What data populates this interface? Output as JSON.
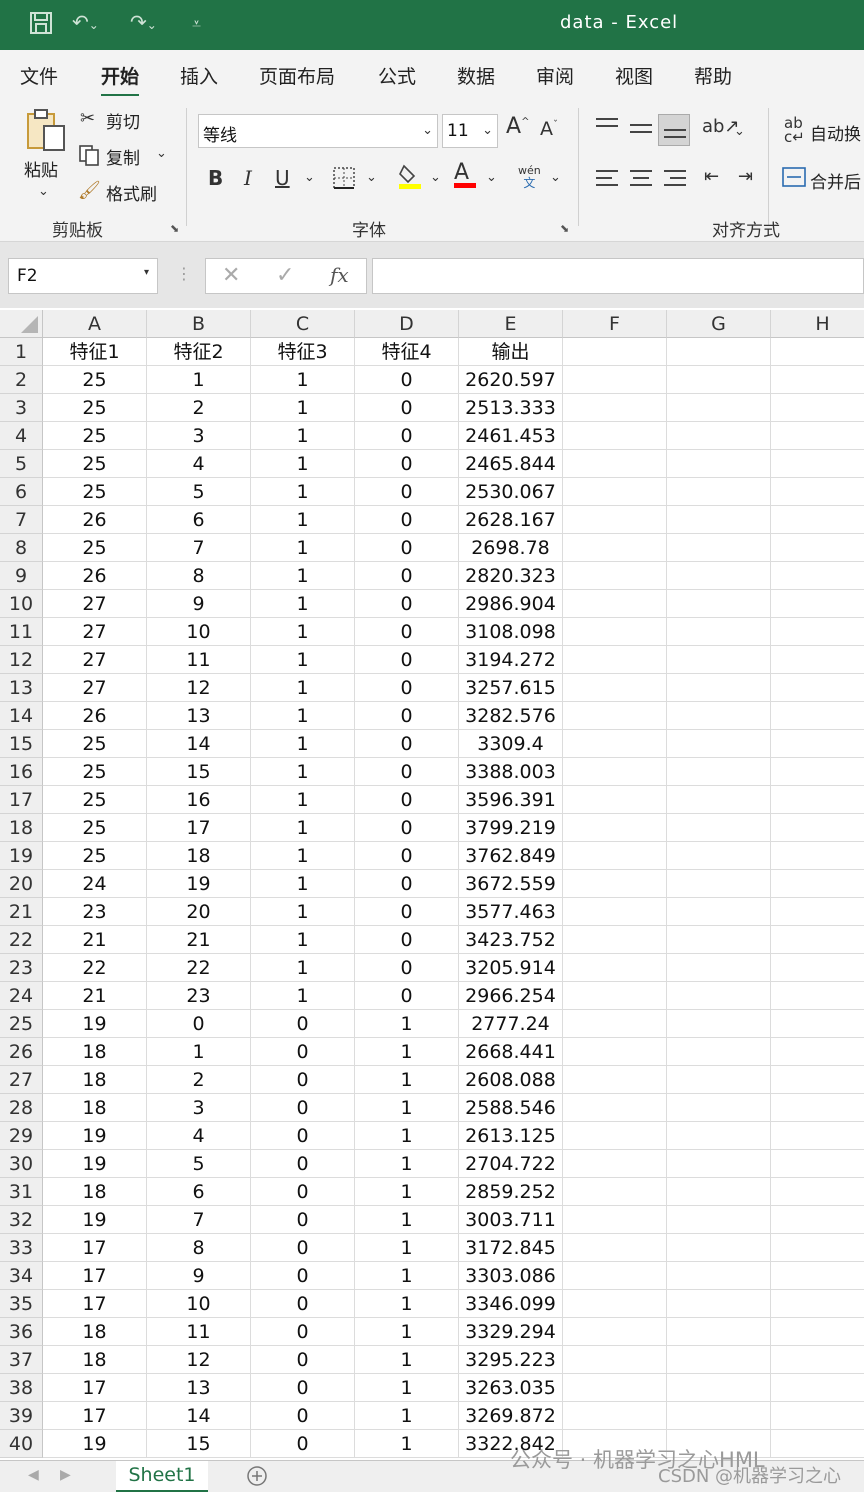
{
  "window": {
    "title": "data  -  Excel"
  },
  "menu": {
    "tabs": [
      "文件",
      "开始",
      "插入",
      "页面布局",
      "公式",
      "数据",
      "审阅",
      "视图",
      "帮助"
    ],
    "active": "开始"
  },
  "ribbon": {
    "clipboard": {
      "paste": "粘贴",
      "cut": "剪切",
      "copy": "复制",
      "format_painter": "格式刷",
      "group": "剪贴板"
    },
    "font": {
      "name": "等线",
      "size": "11",
      "group": "字体",
      "bold": "B",
      "italic": "I",
      "underline": "U",
      "font_color": "A",
      "phonetic_top": "wén",
      "phonetic_bottom": "文"
    },
    "alignment": {
      "wrap": "自动换",
      "merge": "合并后",
      "group": "对齐方式"
    }
  },
  "formula": {
    "name_box": "F2",
    "value": ""
  },
  "grid": {
    "columns": [
      "A",
      "B",
      "C",
      "D",
      "E",
      "F",
      "G",
      "H"
    ],
    "headers": [
      "特征1",
      "特征2",
      "特征3",
      "特征4",
      "输出"
    ],
    "rows": [
      [
        "25",
        "1",
        "1",
        "0",
        "2620.597"
      ],
      [
        "25",
        "2",
        "1",
        "0",
        "2513.333"
      ],
      [
        "25",
        "3",
        "1",
        "0",
        "2461.453"
      ],
      [
        "25",
        "4",
        "1",
        "0",
        "2465.844"
      ],
      [
        "25",
        "5",
        "1",
        "0",
        "2530.067"
      ],
      [
        "26",
        "6",
        "1",
        "0",
        "2628.167"
      ],
      [
        "25",
        "7",
        "1",
        "0",
        "2698.78"
      ],
      [
        "26",
        "8",
        "1",
        "0",
        "2820.323"
      ],
      [
        "27",
        "9",
        "1",
        "0",
        "2986.904"
      ],
      [
        "27",
        "10",
        "1",
        "0",
        "3108.098"
      ],
      [
        "27",
        "11",
        "1",
        "0",
        "3194.272"
      ],
      [
        "27",
        "12",
        "1",
        "0",
        "3257.615"
      ],
      [
        "26",
        "13",
        "1",
        "0",
        "3282.576"
      ],
      [
        "25",
        "14",
        "1",
        "0",
        "3309.4"
      ],
      [
        "25",
        "15",
        "1",
        "0",
        "3388.003"
      ],
      [
        "25",
        "16",
        "1",
        "0",
        "3596.391"
      ],
      [
        "25",
        "17",
        "1",
        "0",
        "3799.219"
      ],
      [
        "25",
        "18",
        "1",
        "0",
        "3762.849"
      ],
      [
        "24",
        "19",
        "1",
        "0",
        "3672.559"
      ],
      [
        "23",
        "20",
        "1",
        "0",
        "3577.463"
      ],
      [
        "21",
        "21",
        "1",
        "0",
        "3423.752"
      ],
      [
        "22",
        "22",
        "1",
        "0",
        "3205.914"
      ],
      [
        "21",
        "23",
        "1",
        "0",
        "2966.254"
      ],
      [
        "19",
        "0",
        "0",
        "1",
        "2777.24"
      ],
      [
        "18",
        "1",
        "0",
        "1",
        "2668.441"
      ],
      [
        "18",
        "2",
        "0",
        "1",
        "2608.088"
      ],
      [
        "18",
        "3",
        "0",
        "1",
        "2588.546"
      ],
      [
        "19",
        "4",
        "0",
        "1",
        "2613.125"
      ],
      [
        "19",
        "5",
        "0",
        "1",
        "2704.722"
      ],
      [
        "18",
        "6",
        "0",
        "1",
        "2859.252"
      ],
      [
        "19",
        "7",
        "0",
        "1",
        "3003.711"
      ],
      [
        "17",
        "8",
        "0",
        "1",
        "3172.845"
      ],
      [
        "17",
        "9",
        "0",
        "1",
        "3303.086"
      ],
      [
        "17",
        "10",
        "0",
        "1",
        "3346.099"
      ],
      [
        "18",
        "11",
        "0",
        "1",
        "3329.294"
      ],
      [
        "18",
        "12",
        "0",
        "1",
        "3295.223"
      ],
      [
        "17",
        "13",
        "0",
        "1",
        "3263.035"
      ],
      [
        "17",
        "14",
        "0",
        "1",
        "3269.872"
      ],
      [
        "19",
        "15",
        "0",
        "1",
        "3322.842"
      ]
    ]
  },
  "sheets": {
    "active": "Sheet1"
  },
  "watermark": {
    "line1": "公众号 · 机器学习之心HML",
    "line2": "CSDN @机器学习之心"
  }
}
